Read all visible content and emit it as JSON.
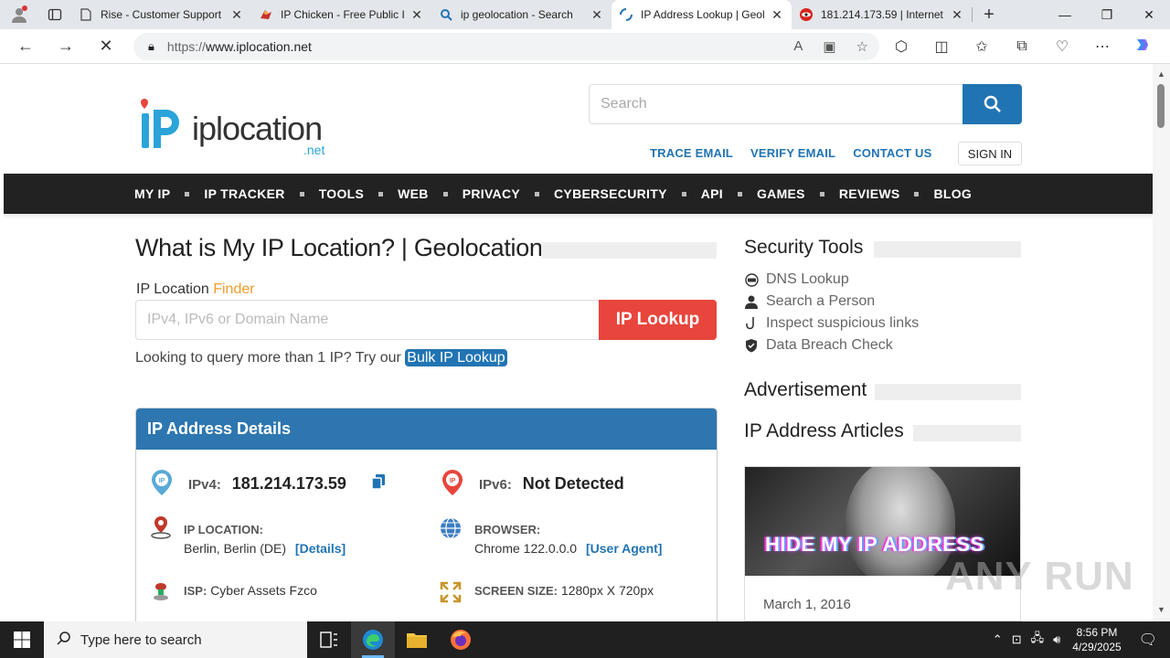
{
  "browser": {
    "tabs": [
      {
        "title": "Rise - Customer Support",
        "icon": "page-icon"
      },
      {
        "title": "IP Chicken - Free Public I",
        "icon": "chicken-icon"
      },
      {
        "title": "ip geolocation - Search",
        "icon": "search-icon"
      },
      {
        "title": "IP Address Lookup | Geol",
        "icon": "loading-icon"
      },
      {
        "title": "181.214.173.59 | Internet",
        "icon": "ipinfo-icon"
      }
    ],
    "url_prefix": "https://",
    "url_host": "www.iplocation.net"
  },
  "site": {
    "logo_main": "iplocation",
    "logo_sub": ".net",
    "search_placeholder": "Search",
    "top_links": [
      "TRACE EMAIL",
      "VERIFY EMAIL",
      "CONTACT US"
    ],
    "sign_in": "SIGN IN",
    "nav": [
      "MY IP",
      "IP TRACKER",
      "TOOLS",
      "WEB",
      "PRIVACY",
      "CYBERSECURITY",
      "API",
      "GAMES",
      "REVIEWS",
      "BLOG"
    ]
  },
  "main": {
    "title": "What is My IP Location? | Geolocation",
    "finder_label": "IP Location ",
    "finder_accent": "Finder",
    "input_placeholder": "IPv4, IPv6 or Domain Name",
    "lookup_button": "IP Lookup",
    "bulk_text": "Looking to query more than 1 IP? Try our ",
    "bulk_link": "Bulk IP Lookup",
    "card_title": "IP Address Details",
    "ipv4_label": "IPv4:",
    "ipv4_value": "181.214.173.59",
    "ipv6_label": "IPv6:",
    "ipv6_value": "Not Detected",
    "location_label": "IP LOCATION:",
    "location_value": "Berlin, Berlin (DE)",
    "location_link": "[Details]",
    "browser_label": "BROWSER:",
    "browser_value": "Chrome 122.0.0.0",
    "browser_link": "[User Agent]",
    "isp_label": "ISP:",
    "isp_value": "Cyber Assets Fzco",
    "screen_label": "SCREEN SIZE:",
    "screen_value": "1280px X 720px"
  },
  "sidebar": {
    "security_title": "Security Tools",
    "tools": [
      "DNS Lookup",
      "Search a Person",
      "Inspect suspicious links",
      "Data Breach Check"
    ],
    "ad_title": "Advertisement",
    "articles_title": "IP Address Articles",
    "article_image_text": "HIDE MY IP ADDRESS",
    "article_date": "March 1, 2016"
  },
  "watermark": "ANY RUN",
  "taskbar": {
    "search_placeholder": "Type here to search",
    "time": "8:56 PM",
    "date": "4/29/2025"
  },
  "colors": {
    "accent_blue": "#2174b3",
    "lookup_red": "#e8453c",
    "finder_orange": "#f39c2b",
    "nav_bg": "#222222"
  }
}
